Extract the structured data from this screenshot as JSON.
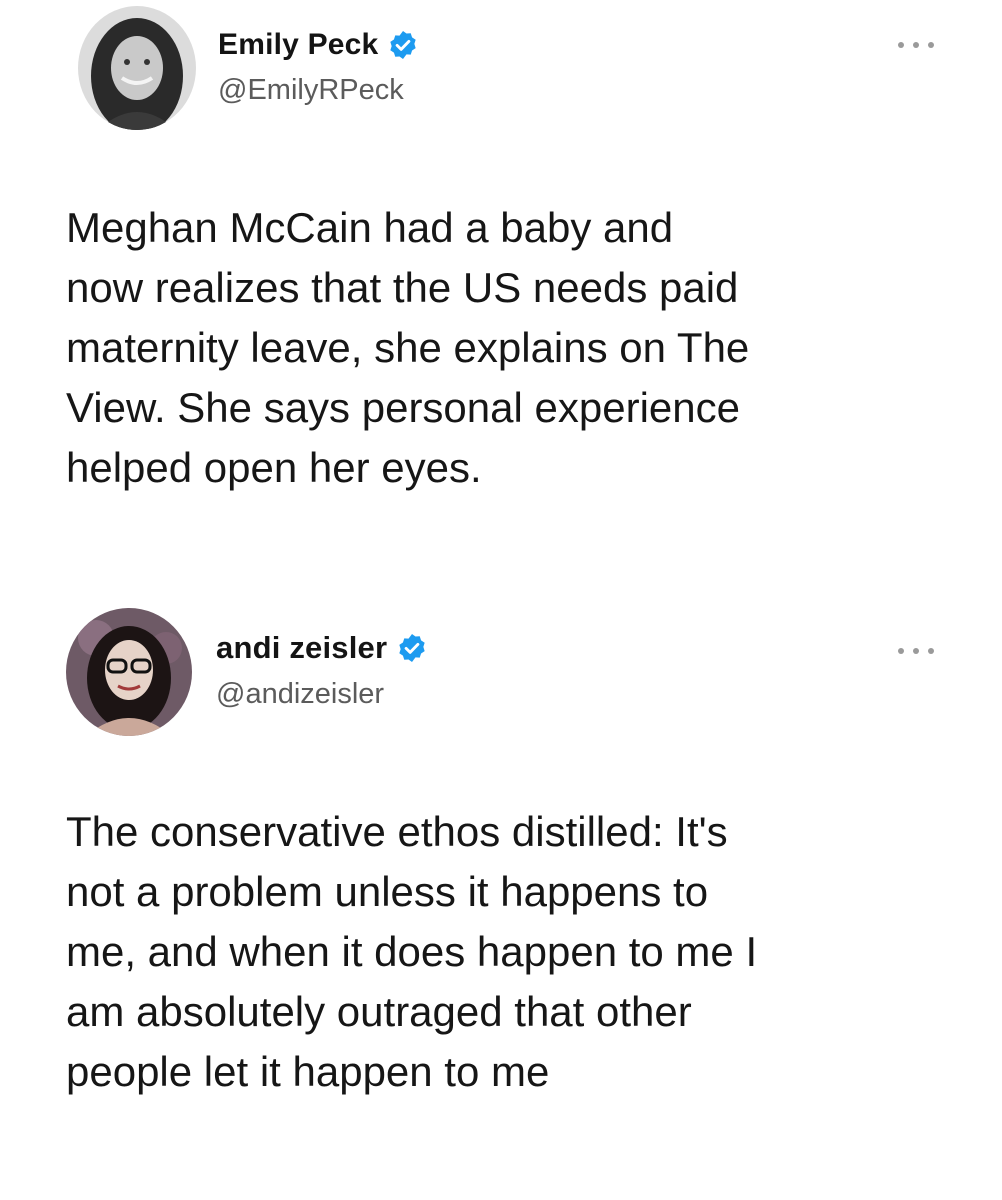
{
  "tweets": [
    {
      "display_name": "Emily Peck",
      "handle": "@EmilyRPeck",
      "verified": true,
      "avatar_icon": "profile-photo",
      "more_icon": "more-options-ellipsis",
      "text_lines": [
        "Meghan McCain had a baby and",
        "now realizes that the US needs paid",
        "maternity leave, she explains on The",
        "View. She says personal experience",
        "helped open her eyes."
      ]
    },
    {
      "display_name": "andi zeisler",
      "handle": "@andizeisler",
      "verified": true,
      "avatar_icon": "profile-photo",
      "more_icon": "more-options-ellipsis",
      "text_lines": [
        "The conservative ethos distilled: It's",
        "not a problem unless it happens to",
        "me, and when it does happen to me I",
        "am absolutely outraged that other",
        "people let it happen to me"
      ]
    }
  ],
  "colors": {
    "verified_badge": "#1d9bf0",
    "handle_text": "#5b5b5b",
    "body_text": "#161616",
    "background": "#ffffff"
  }
}
